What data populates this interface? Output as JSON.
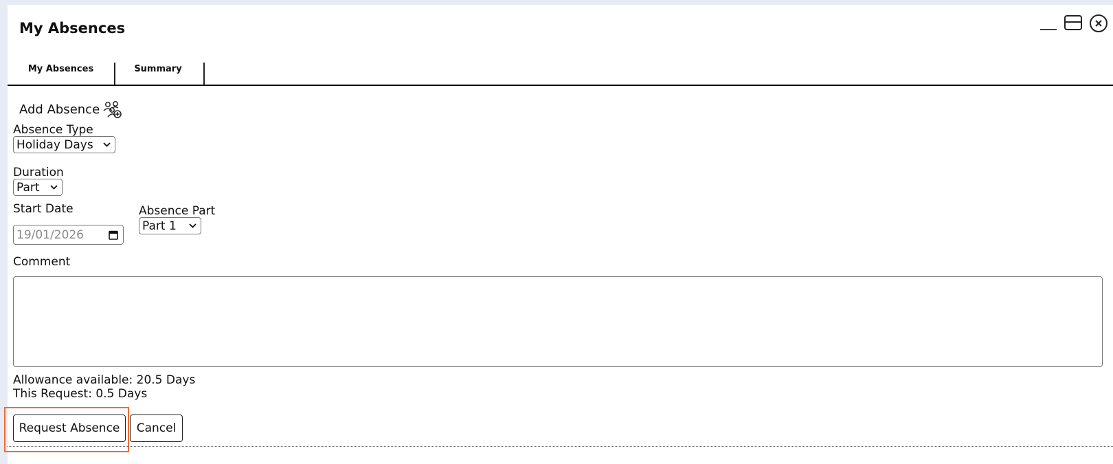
{
  "window": {
    "title": "My Absences"
  },
  "controls": {
    "minimize_icon": "minimize-icon",
    "maximize_icon": "window-icon",
    "close_icon": "close-circle-icon"
  },
  "tabs": [
    {
      "label": "My Absences"
    },
    {
      "label": "Summary"
    }
  ],
  "form": {
    "heading": "Add Absence",
    "heading_icon": "add-users-icon",
    "absence_type": {
      "label": "Absence Type",
      "value": "Holiday Days"
    },
    "duration": {
      "label": "Duration",
      "value": "Part"
    },
    "start_date": {
      "label": "Start Date",
      "value": "19/01/2026"
    },
    "absence_part": {
      "label": "Absence Part",
      "value": "Part 1"
    },
    "comment": {
      "label": "Comment",
      "value": ""
    },
    "allowance": "Allowance available: 20.5 Days",
    "this_request": "This Request: 0.5 Days",
    "request_button": "Request Absence",
    "cancel_button": "Cancel"
  },
  "colors": {
    "background": "#e6ebf5",
    "highlight": "#f26b2b"
  }
}
